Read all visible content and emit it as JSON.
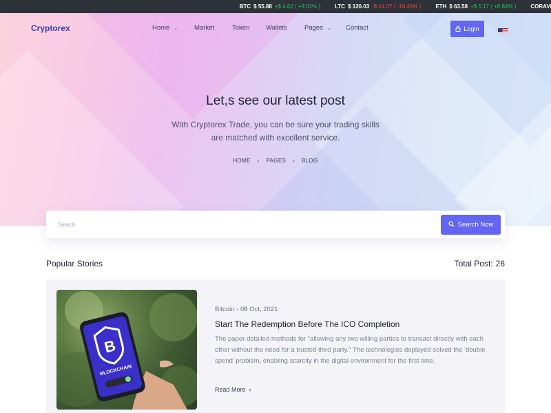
{
  "ticker": [
    {
      "symbol": "BTC",
      "price": "$ 55.88",
      "change": "+$ 4.62 ( +9.01% )",
      "direction": "up"
    },
    {
      "symbol": "LTC",
      "price": "$ 120.03",
      "change": "-$ 14.07 ( -10.49% )",
      "direction": "down"
    },
    {
      "symbol": "ETH",
      "price": "$ 63.58",
      "change": "+$ 5.17 ( +8.84% )",
      "direction": "up"
    },
    {
      "symbol": "CORAVE",
      "price": "",
      "change": "",
      "direction": "up"
    }
  ],
  "brand": {
    "logo": "Cryptorex"
  },
  "nav": {
    "items": [
      {
        "label": "Home",
        "dropdown": true
      },
      {
        "label": "Market",
        "dropdown": false
      },
      {
        "label": "Token",
        "dropdown": false
      },
      {
        "label": "Wallets",
        "dropdown": false
      },
      {
        "label": "Pages",
        "dropdown": true
      },
      {
        "label": "Contact",
        "dropdown": false
      }
    ],
    "login_label": "Login",
    "login_icon": "lock-icon",
    "language_icon": "us-flag-icon"
  },
  "hero": {
    "title": "Let,s see our latest post",
    "subtitle_line1": "With Cryptorex Trade, you can be sure your trading skills",
    "subtitle_line2": "are matched with excellent service.",
    "breadcrumb": [
      "HOME",
      "PAGES",
      "BLOG"
    ]
  },
  "search": {
    "placeholder": "Search",
    "button_label": "Search Now",
    "button_icon": "search-icon"
  },
  "section": {
    "title": "Popular Stories",
    "total_label": "Total Post:",
    "total_value": "26"
  },
  "post": {
    "meta": "Bitcoin - 08 Oct, 2021",
    "title": "Start The Redemption Before The ICO Completion",
    "excerpt": "The paper detailed methods for \"allowing any two willing parties to transact directly with each other without the need for a trusted third party.\" The technologies deployed solved the 'double spend' problem, enabling scarcity in the digital environment for the first time.",
    "read_more": "Read More",
    "image_label": "BLOCKCHAIN"
  },
  "colors": {
    "accent": "#6366f1",
    "up": "#22c55e",
    "down": "#ef4444",
    "ticker_bg": "#2d3138"
  }
}
